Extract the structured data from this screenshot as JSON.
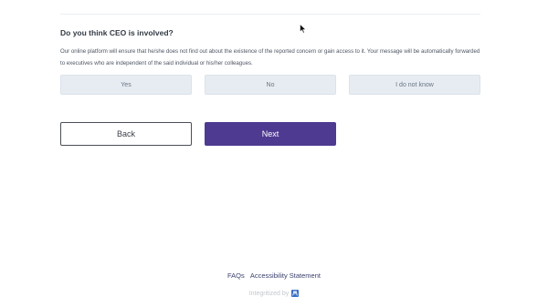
{
  "question": {
    "title": "Do you think CEO is involved?",
    "description": "Our online platform will ensure that he/she does not find out about the existence of the reported concern or gain access to it. Your message will be automatically forwarded to executives who are independent of the said individual or his/her colleagues."
  },
  "options": [
    {
      "label": "Yes"
    },
    {
      "label": "No"
    },
    {
      "label": "I do not know"
    }
  ],
  "navigation": {
    "back_label": "Back",
    "next_label": "Next"
  },
  "footer": {
    "faqs_label": "FAQs",
    "accessibility_label": "Accessibility Statement",
    "credit_text": "Integritized by",
    "credit_logo_icon": "integritized-logo-icon"
  },
  "colors": {
    "primary": "#4e3a91",
    "option_bg": "#e6ecf2",
    "logo": "#3b6fc4"
  }
}
